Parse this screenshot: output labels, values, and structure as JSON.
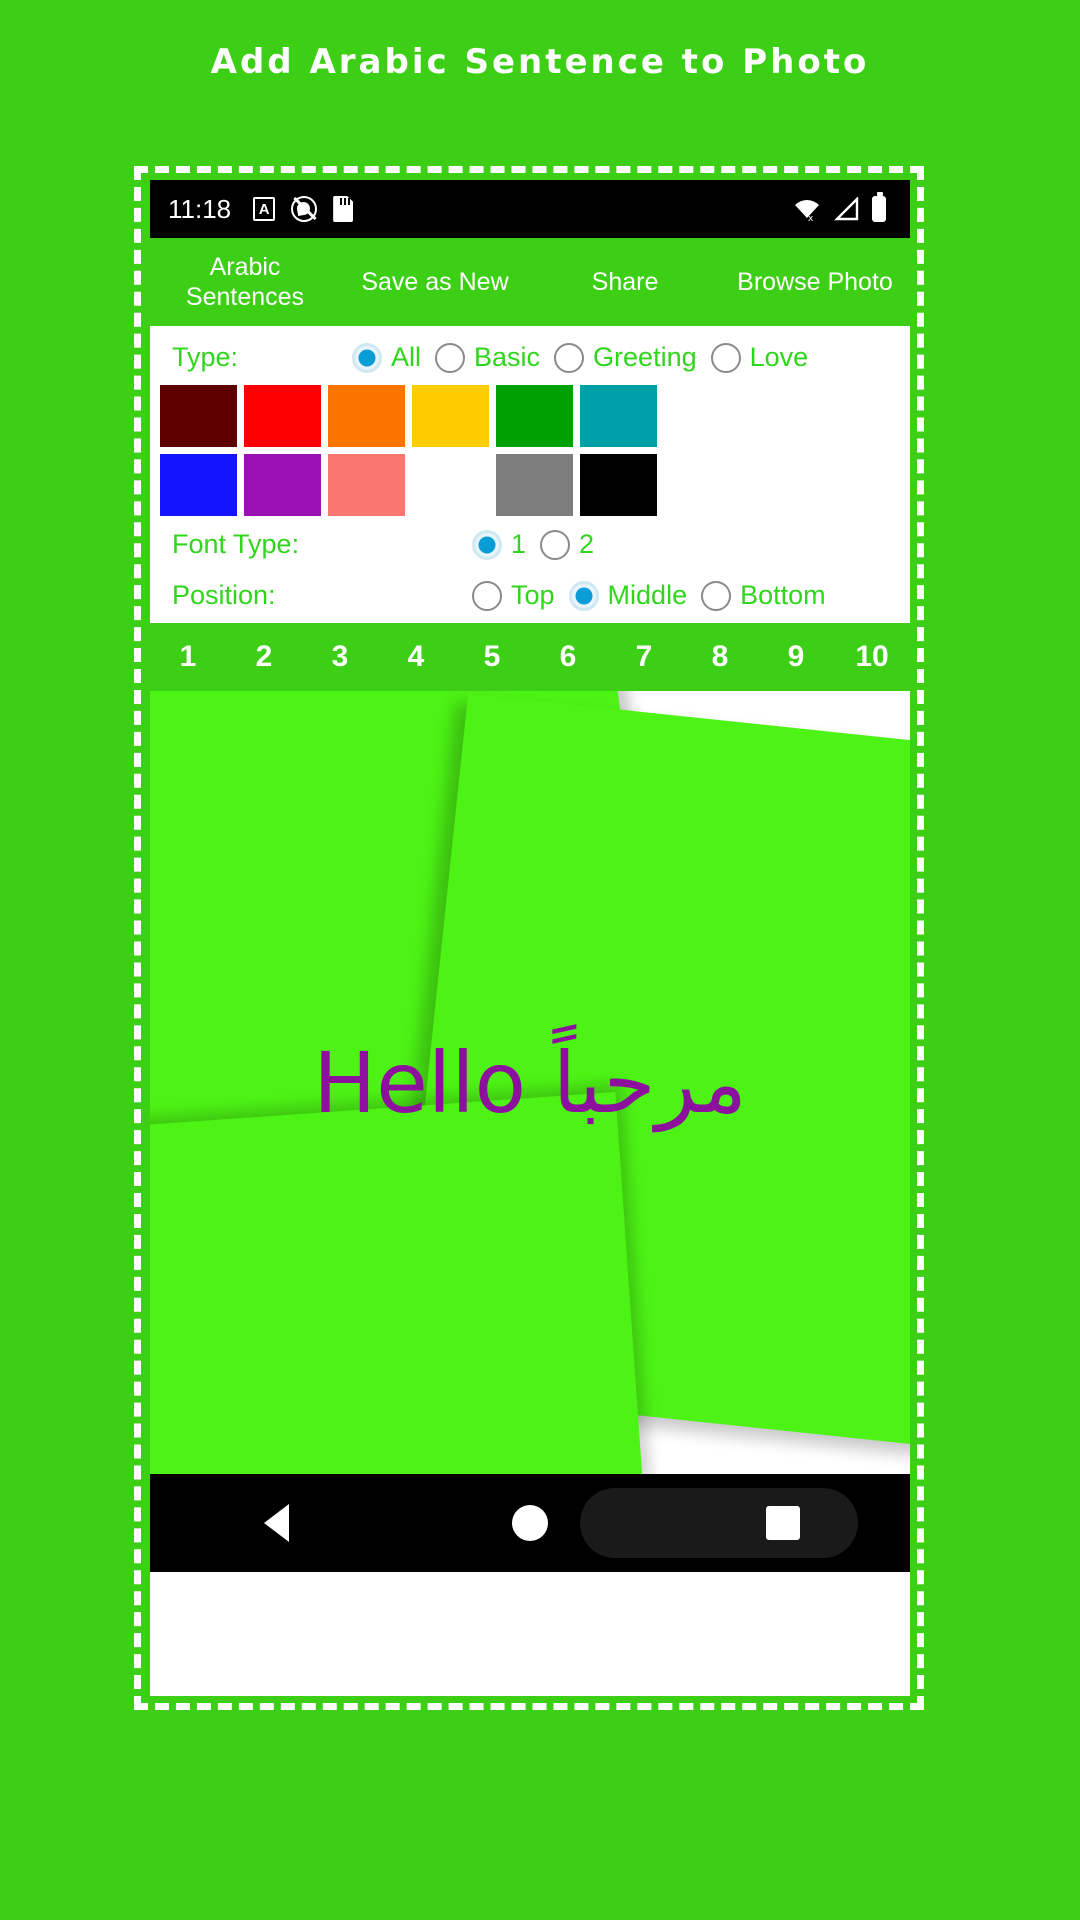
{
  "page": {
    "title": "Add Arabic Sentence to Photo",
    "background_color": "#3dcf16",
    "accent_color": "#2fd61b",
    "radio_color": "#0a9cd4"
  },
  "statusbar": {
    "time": "11:18",
    "left_icons": [
      "letter-a-badge-icon",
      "do-not-disturb-icon",
      "sd-card-icon"
    ],
    "right_icons": [
      "wifi-no-internet-icon",
      "cellular-signal-icon",
      "battery-full-icon"
    ]
  },
  "tabs": [
    {
      "label": "Arabic Sentences",
      "name": "tab-arabic-sentences"
    },
    {
      "label": "Save as New",
      "name": "tab-save-as-new"
    },
    {
      "label": "Share",
      "name": "tab-share"
    },
    {
      "label": "Browse Photo",
      "name": "tab-browse-photo"
    }
  ],
  "options": {
    "type": {
      "label": "Type:",
      "choices": [
        {
          "label": "All",
          "checked": true
        },
        {
          "label": "Basic",
          "checked": false
        },
        {
          "label": "Greeting",
          "checked": false
        },
        {
          "label": "Love",
          "checked": false
        }
      ]
    },
    "colors": {
      "row1": [
        "#5c0000",
        "#ff0000",
        "#fa7500",
        "#ffcc00",
        "#00a000",
        "#00a0a8"
      ],
      "row2": [
        "#1414ff",
        "#9a12b3",
        "#fa7770",
        "#ffffff",
        "#7d7d7d",
        "#000000"
      ]
    },
    "font_type": {
      "label": "Font Type:",
      "choices": [
        {
          "label": "1",
          "checked": true
        },
        {
          "label": "2",
          "checked": false
        }
      ]
    },
    "position": {
      "label": "Position:",
      "choices": [
        {
          "label": "Top",
          "checked": false
        },
        {
          "label": "Middle",
          "checked": true
        },
        {
          "label": "Bottom",
          "checked": false
        }
      ]
    }
  },
  "numbers": [
    "1",
    "2",
    "3",
    "4",
    "5",
    "6",
    "7",
    "8",
    "9",
    "10"
  ],
  "photo": {
    "overlay_text": "مرحباً Hello",
    "overlay_color": "#8d0f9e"
  },
  "navbar": {
    "back": "back-nav",
    "home": "home-nav",
    "recents": "recents-nav"
  }
}
